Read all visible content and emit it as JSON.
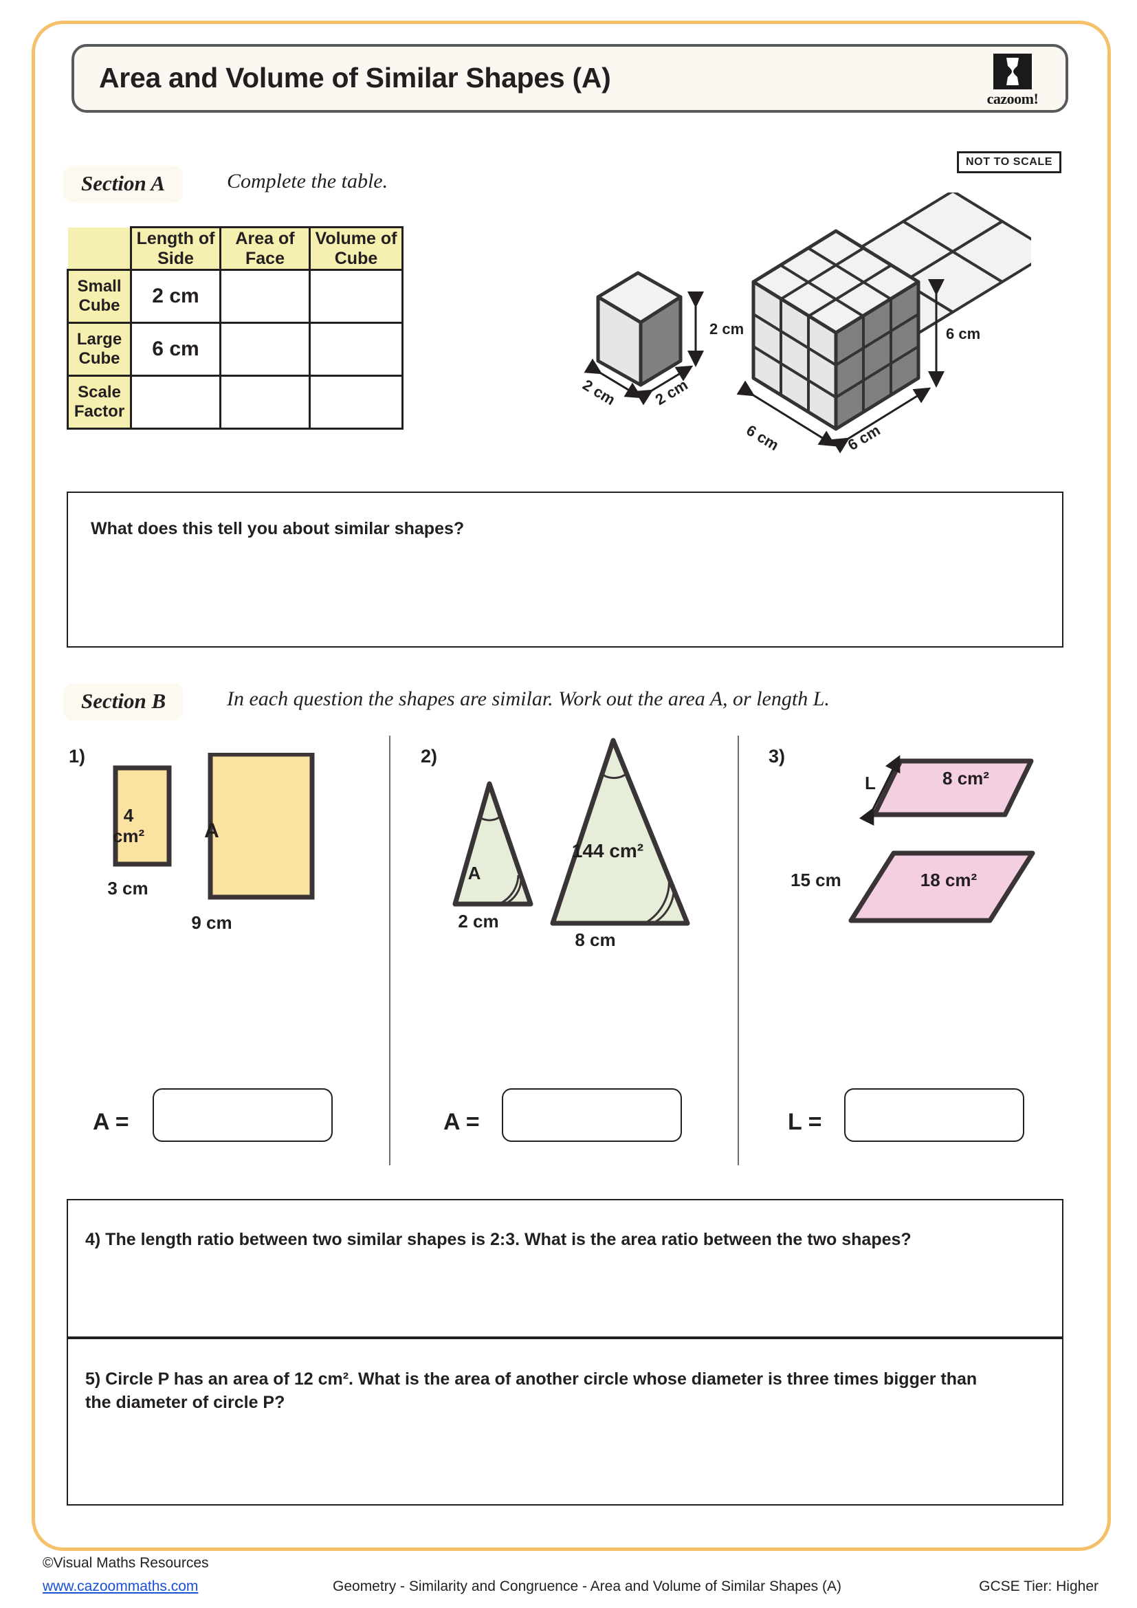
{
  "document": {
    "title": "Area and Volume of Similar Shapes (A)",
    "logo_word": "cazoom!",
    "logo_mark_icon": "cazoom-goblet-icon",
    "not_to_scale_badge": "NOT TO SCALE",
    "accent_color": "#f5c06a",
    "frame_color": "#58595b"
  },
  "section_a": {
    "label": "Section A",
    "instruction": "Complete the table.",
    "table": {
      "corner": "",
      "columns": [
        "Length of Side",
        "Area of Face",
        "Volume of Cube"
      ],
      "rows": [
        {
          "header": "Small Cube",
          "cells": [
            "2 cm",
            "",
            ""
          ]
        },
        {
          "header": "Large Cube",
          "cells": [
            "6 cm",
            "",
            ""
          ]
        },
        {
          "header": "Scale Factor",
          "cells": [
            "",
            "",
            ""
          ]
        }
      ],
      "header_fill": "#f5efb0",
      "cell_fill": "#ffffff"
    },
    "figures": {
      "small_cube": {
        "name": "small-cube",
        "height_label": "2 cm",
        "left_depth_label": "2 cm",
        "right_depth_label": "2 cm",
        "top_face_color": "#f2f2f2",
        "left_face_color": "#e6e6e6",
        "right_face_color": "#808080"
      },
      "large_cube": {
        "name": "large-cube",
        "divisions": 3,
        "height_label": "6 cm",
        "left_depth_label": "6 cm",
        "right_depth_label": "6 cm",
        "top_face_color": "#f2f2f2",
        "left_face_color": "#e6e6e6",
        "right_face_color": "#808080"
      }
    },
    "followup_question": "What does this tell you about similar shapes?"
  },
  "section_b": {
    "label": "Section B",
    "instruction": "In each question the shapes are similar. Work out the area A, or length L.",
    "questions": [
      {
        "number": "1)",
        "shape_type": "rectangles",
        "fill_color": "#fae2a0",
        "small": {
          "inner_label_line1": "4",
          "inner_label_line2": "cm²",
          "base_label": "3 cm"
        },
        "large": {
          "inner_label": "A",
          "base_label": "9 cm"
        },
        "answer_label": "A ="
      },
      {
        "number": "2)",
        "shape_type": "triangles",
        "fill_color": "#e6eeda",
        "small": {
          "inner_label": "A",
          "base_label": "2 cm"
        },
        "large": {
          "inner_label": "144 cm²",
          "base_label": "8 cm"
        },
        "answer_label": "A ="
      },
      {
        "number": "3)",
        "shape_type": "parallelograms",
        "fill_color": "#f4cfe2",
        "small": {
          "inner_label": "8 cm²",
          "side_label": "L"
        },
        "large": {
          "inner_label": "18 cm²",
          "side_label": "15 cm"
        },
        "answer_label": "L ="
      }
    ],
    "written_questions": [
      "4) The length ratio between two similar shapes is 2:3. What is the area ratio between the two shapes?",
      "5) Circle P has an area of 12 cm². What is the area of another circle whose diameter is three times bigger than the diameter of circle P?"
    ]
  },
  "footer": {
    "copyright": "©Visual Maths Resources",
    "website": "www.cazoommaths.com",
    "center": "Geometry - Similarity and Congruence - Area and Volume of Similar Shapes (A)",
    "tier": "GCSE Tier: Higher",
    "link_color": "#1a4fd6"
  }
}
